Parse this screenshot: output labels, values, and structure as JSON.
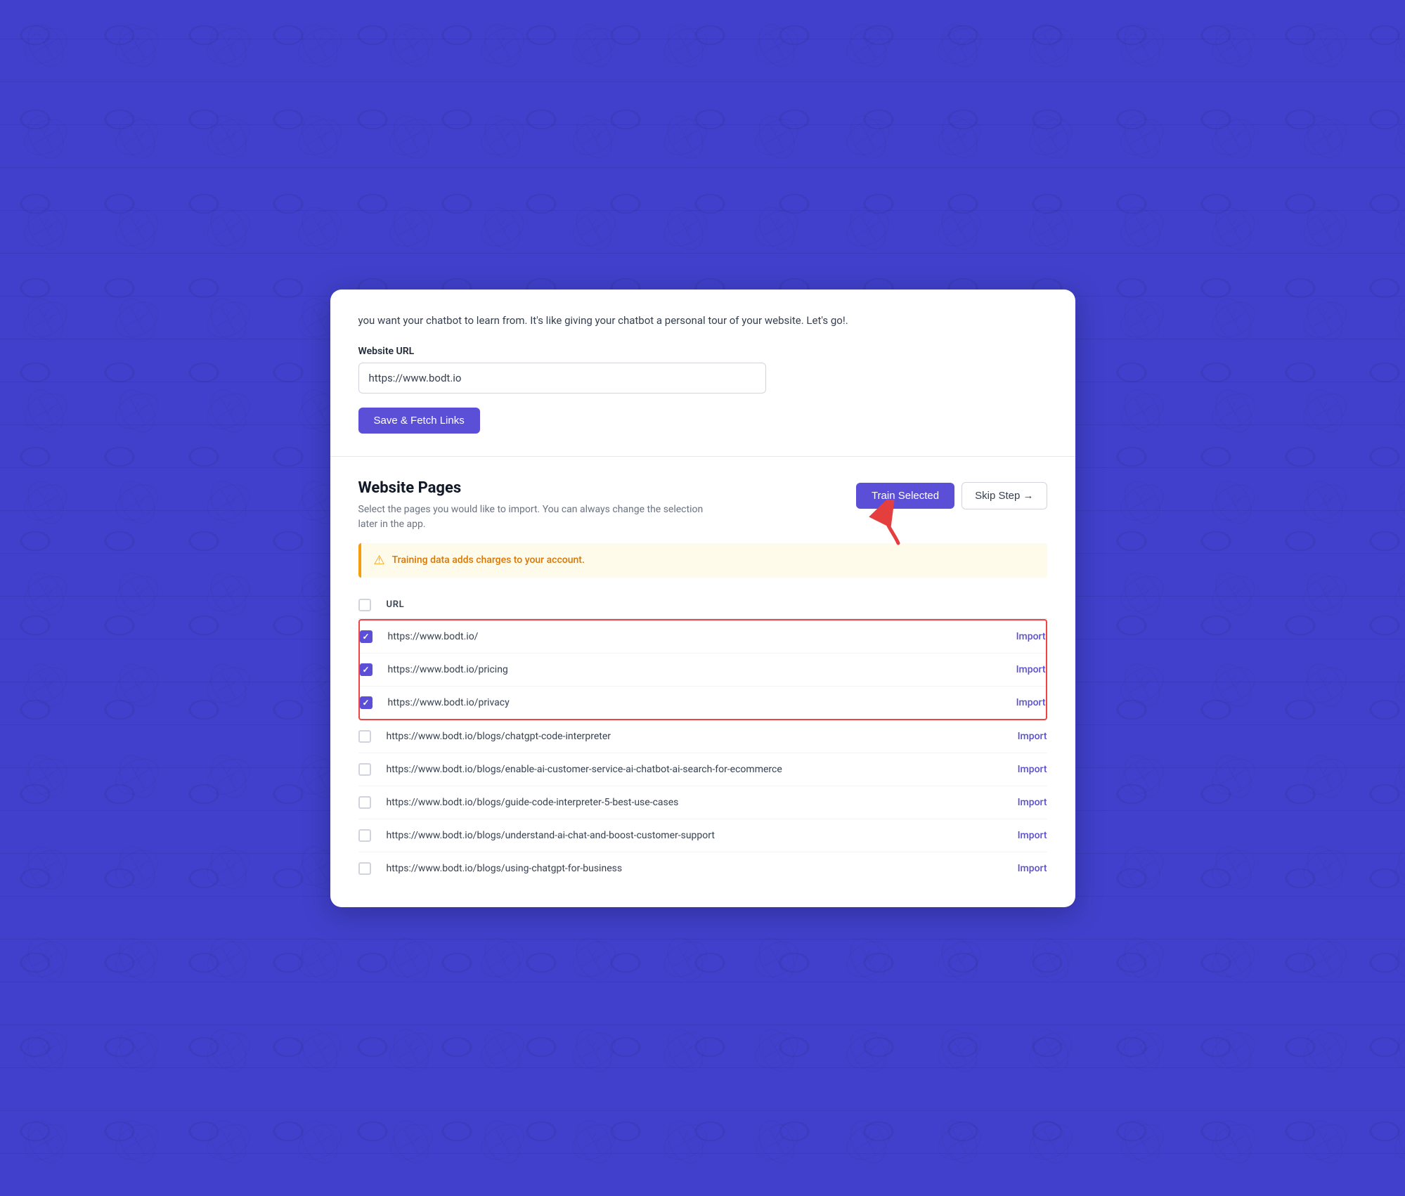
{
  "background": {
    "color": "#4545cc"
  },
  "top_section": {
    "intro_text": "you want your chatbot to learn from. It's like giving your chatbot a personal tour of your website. Let's go!.",
    "website_url_label": "Website URL",
    "website_url_value": "https://www.bodt.io",
    "fetch_button_label": "Save & Fetch Links"
  },
  "website_pages_section": {
    "title": "Website Pages",
    "subtitle": "Select the pages you would like to import. You can always change the selection later in the app.",
    "train_button_label": "Train Selected",
    "skip_button_label": "Skip Step →",
    "warning_text": "Training data adds charges to your account.",
    "url_column_header": "URL",
    "urls": [
      {
        "url": "https://www.bodt.io/",
        "checked": true,
        "import_label": "Import"
      },
      {
        "url": "https://www.bodt.io/pricing",
        "checked": true,
        "import_label": "Import"
      },
      {
        "url": "https://www.bodt.io/privacy",
        "checked": true,
        "import_label": "Import"
      },
      {
        "url": "https://www.bodt.io/blogs/chatgpt-code-interpreter",
        "checked": false,
        "import_label": "Import",
        "partial": true
      },
      {
        "url": "https://www.bodt.io/blogs/enable-ai-customer-service-ai-chatbot-ai-search-for-ecommerce",
        "checked": false,
        "import_label": "Import"
      },
      {
        "url": "https://www.bodt.io/blogs/guide-code-interpreter-5-best-use-cases",
        "checked": false,
        "import_label": "Import"
      },
      {
        "url": "https://www.bodt.io/blogs/understand-ai-chat-and-boost-customer-support",
        "checked": false,
        "import_label": "Import"
      },
      {
        "url": "https://www.bodt.io/blogs/using-chatgpt-for-business",
        "checked": false,
        "import_label": "Import"
      }
    ]
  }
}
